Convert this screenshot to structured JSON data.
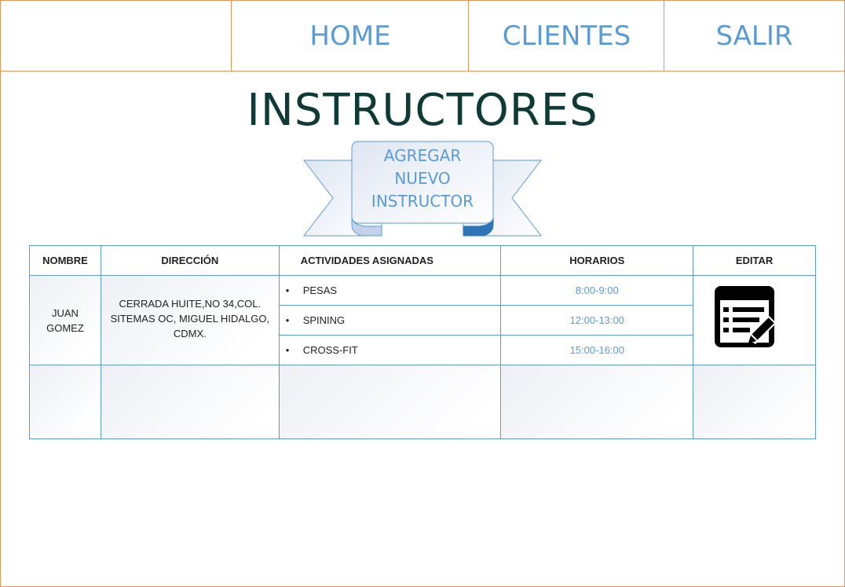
{
  "nav": {
    "home": "HOME",
    "clientes": "CLIENTES",
    "salir": "SALIR"
  },
  "page_title": "INSTRUCTORES",
  "add_button": {
    "line1": "AGREGAR",
    "line2": "NUEVO",
    "line3": "INSTRUCTOR"
  },
  "table": {
    "headers": [
      "NOMBRE",
      "DIRECCIÓN",
      "ACTIVIDADES ASIGNADAS",
      "HORARIOS",
      "EDITAR"
    ],
    "rows": [
      {
        "nombre_line1": "JUAN",
        "nombre_line2": "GOMEZ",
        "direccion_line1": "CERRADA HUITE,NO 34,COL.",
        "direccion_line2": "SITEMAS OC, MIGUEL HIDALGO,",
        "direccion_line3": "CDMX.",
        "actividades": [
          "PESAS",
          "SPINING",
          "CROSS-FIT"
        ],
        "horarios": [
          "8:00-9:00",
          "12:00-13:00",
          "15:00-16:00"
        ],
        "editar_icon": "edit-document-icon"
      }
    ]
  },
  "colors": {
    "accent": "#5b9bd5",
    "border": "#e8975a",
    "title": "#0f3b36"
  }
}
